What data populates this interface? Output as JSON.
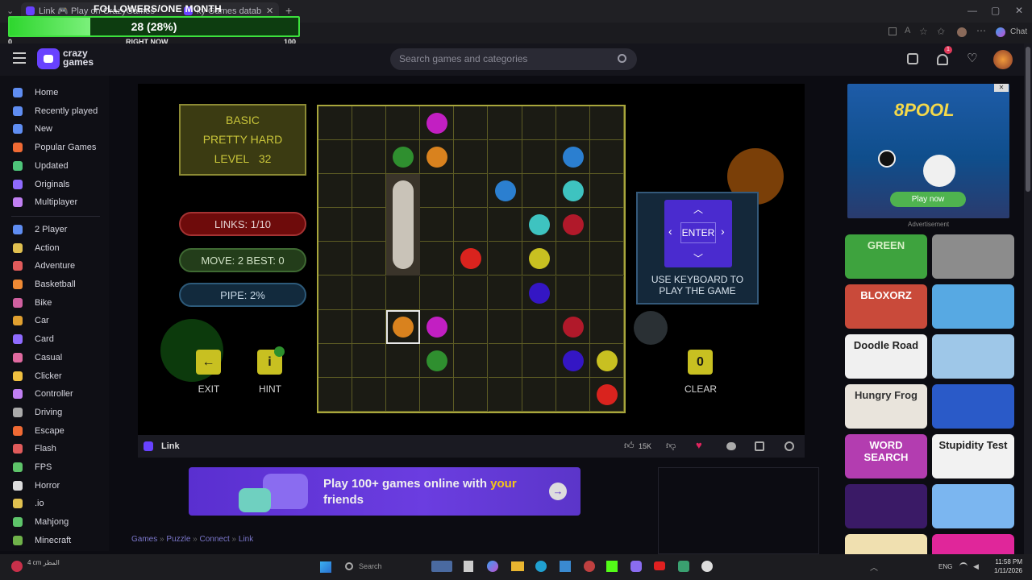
{
  "browser": {
    "tab_title": "Link 🎮 Play on CrazyGames",
    "tab2_title": "ky Games datab",
    "chat_label": "Chat"
  },
  "overlay": {
    "title": "FOLLOWERS/ONE MONTH",
    "progress_text": "28 (28%)",
    "progress_value": 0.28,
    "min_label": "0",
    "mid_label": "RIGHT NOW",
    "max_label": "100"
  },
  "header": {
    "logo_text": "crazy games",
    "search_placeholder": "Search games and categories",
    "notification_count": "1"
  },
  "sidebar": {
    "items": [
      {
        "label": "Home",
        "icon": "home-icon",
        "color": "#5f8df2"
      },
      {
        "label": "Recently played",
        "icon": "clock-icon",
        "color": "#5f8df2"
      },
      {
        "label": "New",
        "icon": "sparkle-icon",
        "color": "#5f8df2"
      },
      {
        "label": "Popular Games",
        "icon": "flame-icon",
        "color": "#f06a34"
      },
      {
        "label": "Updated",
        "icon": "refresh-icon",
        "color": "#4ec47a"
      },
      {
        "label": "Originals",
        "icon": "originals-icon",
        "color": "#8f6bff"
      },
      {
        "label": "Multiplayer",
        "icon": "people-icon",
        "color": "#c07ff2"
      },
      {
        "label": "2 Player",
        "icon": "two-player-icon",
        "color": "#5f8df2"
      },
      {
        "label": "Action",
        "icon": "sword-icon",
        "color": "#e0c050"
      },
      {
        "label": "Adventure",
        "icon": "compass-icon",
        "color": "#e05b5b"
      },
      {
        "label": "Basketball",
        "icon": "basketball-icon",
        "color": "#f08a34"
      },
      {
        "label": "Bike",
        "icon": "bike-icon",
        "color": "#d060a0"
      },
      {
        "label": "Car",
        "icon": "car-icon",
        "color": "#e0a030"
      },
      {
        "label": "Card",
        "icon": "card-icon",
        "color": "#8f6bff"
      },
      {
        "label": "Casual",
        "icon": "casual-icon",
        "color": "#e06aa0"
      },
      {
        "label": "Clicker",
        "icon": "pointer-icon",
        "color": "#f0c040"
      },
      {
        "label": "Controller",
        "icon": "gamepad-icon",
        "color": "#c07ff2"
      },
      {
        "label": "Driving",
        "icon": "steering-icon",
        "color": "#aaaaaa"
      },
      {
        "label": "Escape",
        "icon": "door-icon",
        "color": "#f06a34"
      },
      {
        "label": "Flash",
        "icon": "flash-icon",
        "color": "#e05b5b"
      },
      {
        "label": "FPS",
        "icon": "crosshair-icon",
        "color": "#5ec46a"
      },
      {
        "label": "Horror",
        "icon": "ghost-icon",
        "color": "#dddddd"
      },
      {
        "label": ".io",
        "icon": "io-icon",
        "color": "#e0c050"
      },
      {
        "label": "Mahjong",
        "icon": "mahjong-icon",
        "color": "#5ec46a"
      },
      {
        "label": "Minecraft",
        "icon": "block-icon",
        "color": "#6fb24a"
      }
    ]
  },
  "game": {
    "mode": "BASIC",
    "difficulty": "PRETTY HARD",
    "level_label": "LEVEL",
    "level": "32",
    "links": "LINKS:   1/10",
    "move_best": "MOVE: 2    BEST: 0",
    "pipe": "PIPE:   2%",
    "exit_label": "EXIT",
    "hint_label": "HINT",
    "clear_label": "CLEAR",
    "clear_value": "0",
    "enter_label": "ENTER",
    "keyboard_hint": "USE KEYBOARD TO PLAY THE GAME",
    "grid_size": 9,
    "dots": [
      {
        "r": 0,
        "c": 3,
        "color": "#c21fc2"
      },
      {
        "r": 1,
        "c": 2,
        "color": "#2f8f2f"
      },
      {
        "r": 1,
        "c": 3,
        "color": "#d9821e"
      },
      {
        "r": 1,
        "c": 7,
        "color": "#2b7fd0"
      },
      {
        "r": 2,
        "c": 5,
        "color": "#2b7fd0"
      },
      {
        "r": 2,
        "c": 7,
        "color": "#3ec3c0"
      },
      {
        "r": 3,
        "c": 6,
        "color": "#3ec3c0"
      },
      {
        "r": 3,
        "c": 7,
        "color": "#b1192a"
      },
      {
        "r": 4,
        "c": 4,
        "color": "#d9231e"
      },
      {
        "r": 4,
        "c": 6,
        "color": "#c8c021"
      },
      {
        "r": 5,
        "c": 6,
        "color": "#3416c4"
      },
      {
        "r": 6,
        "c": 2,
        "color": "#d9821e"
      },
      {
        "r": 6,
        "c": 3,
        "color": "#c21fc2"
      },
      {
        "r": 6,
        "c": 7,
        "color": "#b1192a"
      },
      {
        "r": 7,
        "c": 3,
        "color": "#2f8f2f"
      },
      {
        "r": 7,
        "c": 7,
        "color": "#3416c4"
      },
      {
        "r": 7,
        "c": 8,
        "color": "#c8c021"
      },
      {
        "r": 8,
        "c": 8,
        "color": "#d9231e"
      }
    ],
    "pipe_segment": {
      "c": 2,
      "r_start": 2,
      "r_end": 4,
      "color": "#c9c3b8"
    },
    "selected_cell": {
      "r": 6,
      "c": 2
    }
  },
  "game_bar": {
    "title": "Link",
    "likes": "15K"
  },
  "banner": {
    "text_a": "Play 100+ games online with ",
    "text_b": "your",
    "text_c": "friends"
  },
  "breadcrumb": {
    "items": [
      "Games",
      "Puzzle",
      "Connect",
      "Link"
    ]
  },
  "ad": {
    "game_title": "8POOL",
    "button": "Play now",
    "label": "Advertisement"
  },
  "thumbnails": [
    {
      "label": "GREEN",
      "bg": "#3ea33e",
      "fg": "#d8f0c8"
    },
    {
      "label": "",
      "bg": "#8c8c8c",
      "fg": "#ffffff"
    },
    {
      "label": "BLOXORZ",
      "bg": "#c94a3a",
      "fg": "#ffffff"
    },
    {
      "label": "",
      "bg": "#57a9e3",
      "fg": "#ffffff"
    },
    {
      "label": "Doodle Road",
      "bg": "#f0f0f0",
      "fg": "#222222"
    },
    {
      "label": "",
      "bg": "#9ec7e8",
      "fg": "#2a5aa8"
    },
    {
      "label": "Hungry Frog",
      "bg": "#e9e4dc",
      "fg": "#333333"
    },
    {
      "label": "",
      "bg": "#2a5ac8",
      "fg": "#ffffff"
    },
    {
      "label": "WORD SEARCH",
      "bg": "#b33db0",
      "fg": "#ffffff"
    },
    {
      "label": "Stupidity Test",
      "bg": "#f2f2f2",
      "fg": "#222222"
    },
    {
      "label": "",
      "bg": "#3a1a66",
      "fg": "#ffffff"
    },
    {
      "label": "",
      "bg": "#7bb6f0",
      "fg": "#ffffff"
    },
    {
      "label": "",
      "bg": "#f0e0b0",
      "fg": "#222222"
    },
    {
      "label": "",
      "bg": "#e0269a",
      "fg": "#ffffff"
    }
  ],
  "taskbar": {
    "weather": "4 cm المطر",
    "search": "Search",
    "lang": "ENG",
    "time": "11:58 PM",
    "date": "1/11/2026"
  }
}
